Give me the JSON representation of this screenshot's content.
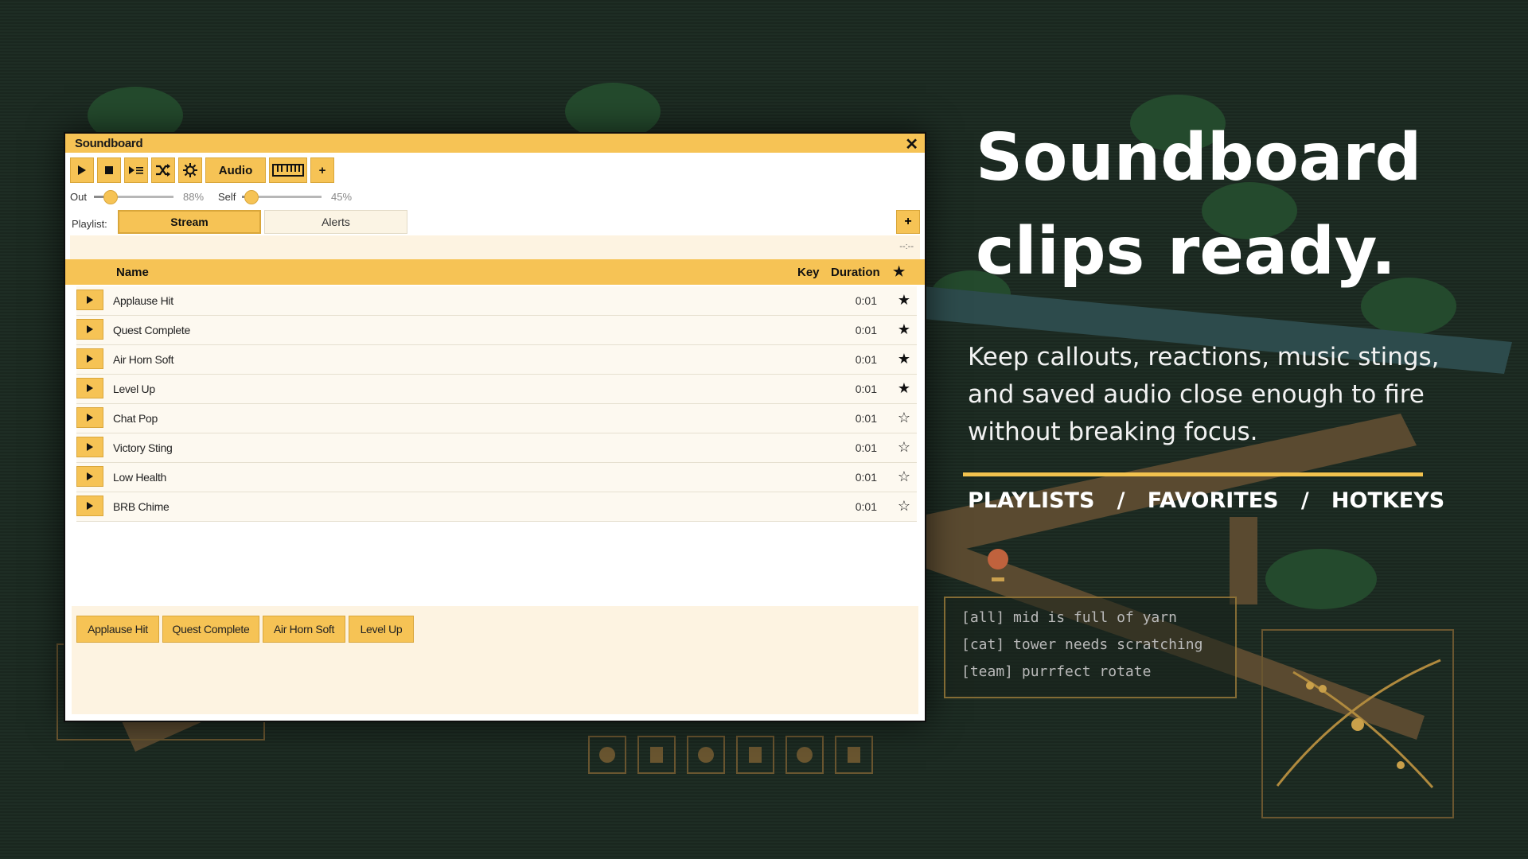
{
  "window": {
    "title": "Soundboard",
    "close_glyph": "✕"
  },
  "toolbar": {
    "buttons": [
      {
        "name": "play",
        "icon": "play-icon"
      },
      {
        "name": "stop",
        "icon": "stop-icon"
      },
      {
        "name": "play-next",
        "icon": "play-next-icon"
      },
      {
        "name": "shuffle",
        "icon": "shuffle-icon"
      },
      {
        "name": "settings",
        "icon": "gear-icon"
      }
    ],
    "audio_label": "Audio",
    "keyboard_icon": "keyboard-icon",
    "add_label": "+"
  },
  "volume": {
    "out_label": "Out",
    "out_value": 0.88,
    "out_display": "88%",
    "self_label": "Self",
    "self_value": 0.45,
    "self_display": "45%"
  },
  "playlists": {
    "label": "Playlist:",
    "tabs": [
      {
        "label": "Stream",
        "active": true
      },
      {
        "label": "Alerts",
        "active": false
      }
    ],
    "add_label": "+"
  },
  "status": {
    "time": "--:--"
  },
  "list": {
    "headers": {
      "name": "Name",
      "key": "Key",
      "duration": "Duration",
      "fav": "★"
    },
    "rows": [
      {
        "name": "Applause Hit",
        "duration": "0:01",
        "favorite": "★"
      },
      {
        "name": "Quest Complete",
        "duration": "0:01",
        "favorite": "★"
      },
      {
        "name": "Air Horn Soft",
        "duration": "0:01",
        "favorite": "★"
      },
      {
        "name": "Level Up",
        "duration": "0:01",
        "favorite": "★"
      },
      {
        "name": "Chat Pop",
        "duration": "0:01",
        "favorite": "☆"
      },
      {
        "name": "Victory Sting",
        "duration": "0:01",
        "favorite": "☆"
      },
      {
        "name": "Low Health",
        "duration": "0:01",
        "favorite": "☆"
      },
      {
        "name": "BRB Chime",
        "duration": "0:01",
        "favorite": "☆"
      }
    ]
  },
  "quick_buttons": [
    "Applause Hit",
    "Quest Complete",
    "Air Horn Soft",
    "Level Up"
  ],
  "hero": {
    "headline_line1": "Soundboard",
    "headline_line2": "clips ready.",
    "subtext": "Keep callouts, reactions, music stings, and saved audio close enough to fire without breaking focus.",
    "tag1": "PLAYLISTS",
    "sep": "/",
    "tag2": "FAVORITES",
    "tag3": "HOTKEYS"
  },
  "game_chat": [
    "[all] mid is full of yarn",
    "[cat] tower needs scratching",
    "[team] purrfect rotate"
  ],
  "colors": {
    "accent": "#f6c355",
    "background": "#1c2a21",
    "rule": "#f2c24e"
  }
}
